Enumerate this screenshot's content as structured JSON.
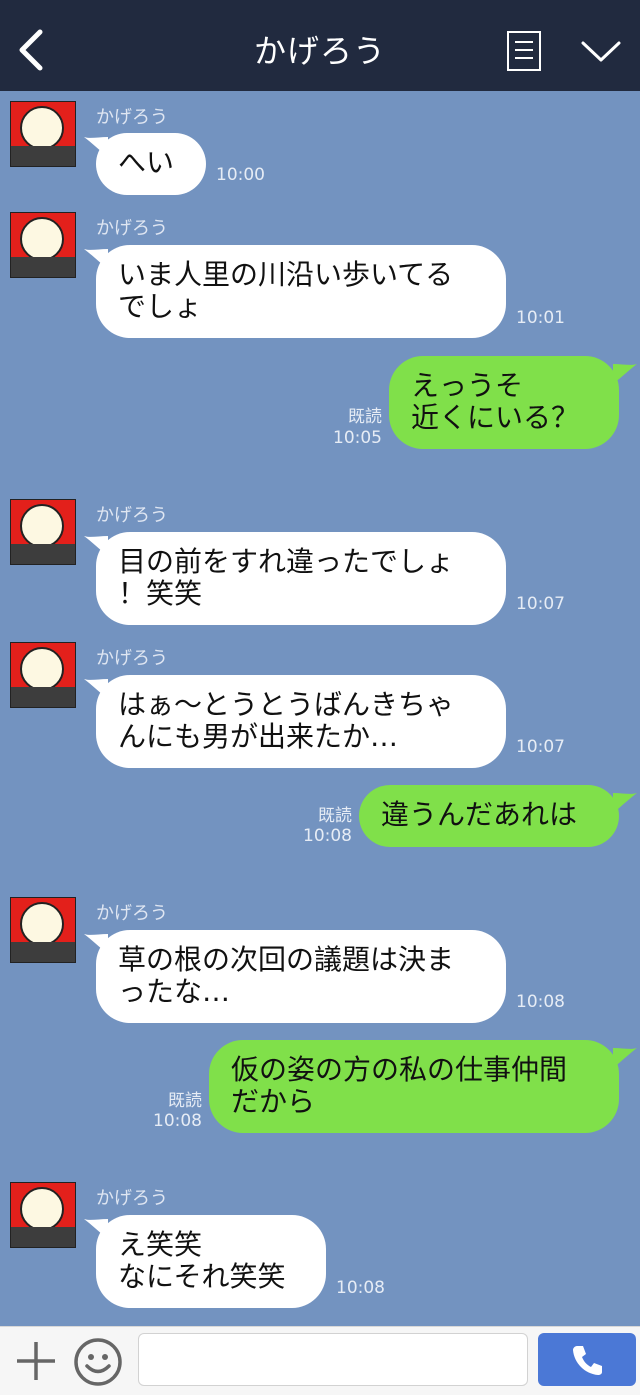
{
  "header": {
    "title": "かげろう",
    "back_icon": "chevron-left-icon",
    "menu_icon": "list-icon",
    "dropdown_icon": "chevron-down-icon"
  },
  "messages": [
    {
      "side": "in",
      "sender": "かげろう",
      "lines": [
        "へい"
      ],
      "time": "10:00"
    },
    {
      "side": "in",
      "sender": "かげろう",
      "lines": [
        "いま人里の川沿い歩いてる",
        "でしょ"
      ],
      "time": "10:01"
    },
    {
      "side": "out",
      "lines": [
        "えっうそ",
        "近くにいる？"
      ],
      "read": "既読",
      "time": "10:05"
    },
    {
      "side": "in",
      "sender": "かげろう",
      "lines": [
        "目の前をすれ違ったでしょ",
        "！笑笑"
      ],
      "time": "10:07"
    },
    {
      "side": "in",
      "sender": "かげろう",
      "lines": [
        "はぁ〜とうとうばんきちゃ",
        "んにも男が出来たか…"
      ],
      "time": "10:07"
    },
    {
      "side": "out",
      "lines": [
        "違うんだあれは"
      ],
      "read": "既読",
      "time": "10:08"
    },
    {
      "side": "in",
      "sender": "かげろう",
      "lines": [
        "草の根の次回の議題は決ま",
        "ったな…"
      ],
      "time": "10:08"
    },
    {
      "side": "out",
      "lines": [
        "仮の姿の方の私の仕事仲間",
        "だから"
      ],
      "read": "既読",
      "time": "10:08"
    },
    {
      "side": "in",
      "sender": "かげろう",
      "lines": [
        "え笑笑",
        "なにそれ笑笑"
      ],
      "time": "10:08"
    }
  ],
  "footer": {
    "plus_icon": "plus-icon",
    "emoji_icon": "smiley-icon",
    "input_placeholder": "",
    "call_icon": "phone-icon"
  },
  "colors": {
    "header": "#212a3f",
    "background": "#7393c0",
    "outgoing": "#80e04a",
    "incoming": "#ffffff",
    "call_button": "#4b78d6"
  }
}
